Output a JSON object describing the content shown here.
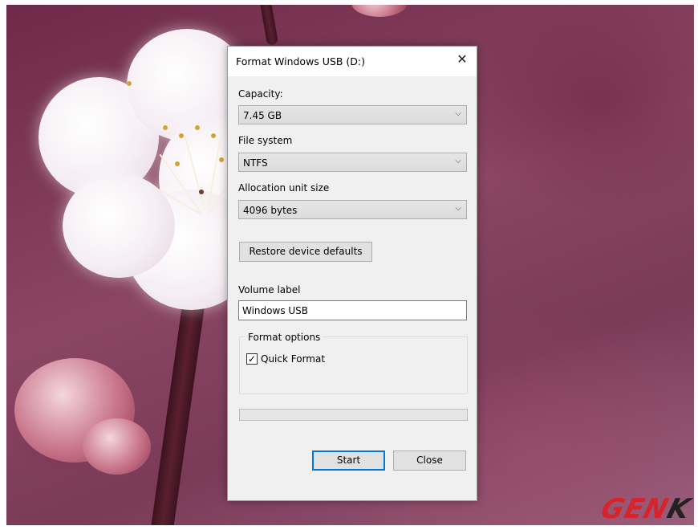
{
  "dialog": {
    "title": "Format Windows USB (D:)",
    "close_glyph": "✕",
    "capacity": {
      "label": "Capacity:",
      "value": "7.45 GB"
    },
    "file_system": {
      "label": "File system",
      "value": "NTFS"
    },
    "allocation": {
      "label": "Allocation unit size",
      "value": "4096 bytes"
    },
    "restore_button": "Restore device defaults",
    "volume": {
      "label": "Volume label",
      "value": "Windows USB"
    },
    "format_options": {
      "legend": "Format options",
      "quick_format_label": "Quick Format",
      "quick_format_checked": true,
      "check_glyph": "✓"
    },
    "progress_fraction": 0,
    "start_button": "Start",
    "close_button": "Close",
    "chevron_glyph": "⌵"
  },
  "watermark": {
    "logo_main": "GEN",
    "logo_end": "K"
  },
  "colors": {
    "dialog_bg": "#f0f0f0",
    "default_button_border": "#0078d7",
    "logo_red": "#d8232a"
  }
}
